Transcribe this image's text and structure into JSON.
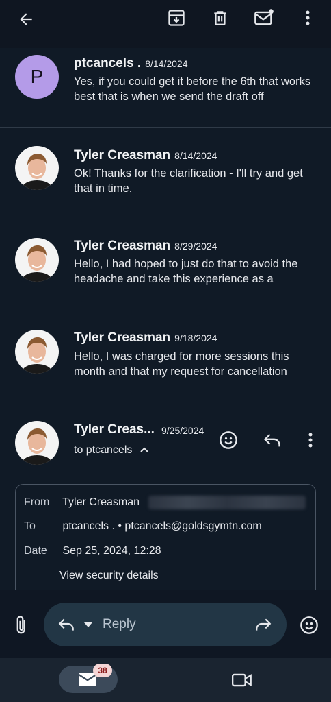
{
  "toolbar": {
    "back_icon": "arrow-left",
    "archive_icon": "archive",
    "delete_icon": "trash",
    "mark_unread_icon": "mail-unread",
    "more_icon": "more-vertical"
  },
  "messages": [
    {
      "sender": "ptcancels .",
      "date": "8/14/2024",
      "avatar_letter": "P",
      "snippet": "Yes, if you could get it before the 6th that works best that is when we send the draft off"
    },
    {
      "sender": "Tyler Creasman",
      "date": "8/14/2024",
      "snippet": "Ok! Thanks for the clarification - I'll try and get that in time."
    },
    {
      "sender": "Tyler Creasman",
      "date": "8/29/2024",
      "snippet": "Hello, I had hoped to just do that to avoid the headache and take this experience as a"
    },
    {
      "sender": "Tyler Creasman",
      "date": "9/18/2024",
      "snippet": "Hello, I was charged for more sessions this month and that my request for cancellation"
    }
  ],
  "expanded": {
    "sender": "Tyler Creas...",
    "date": "9/25/2024",
    "to_line": "to ptcancels",
    "details": {
      "from_label": "From",
      "from_value": "Tyler Creasman",
      "to_label": "To",
      "to_value": "ptcancels . • ptcancels@goldsgymtn.com",
      "date_label": "Date",
      "date_value": "Sep 25, 2024, 12:28",
      "security_link": "View security details"
    }
  },
  "compose": {
    "reply_label": "Reply"
  },
  "nav": {
    "mail_badge": "38"
  },
  "colors": {
    "background": "#0f1723",
    "avatar_p": "#b49be8",
    "reply_pill": "#223645",
    "badge": "#f5d6d6"
  }
}
